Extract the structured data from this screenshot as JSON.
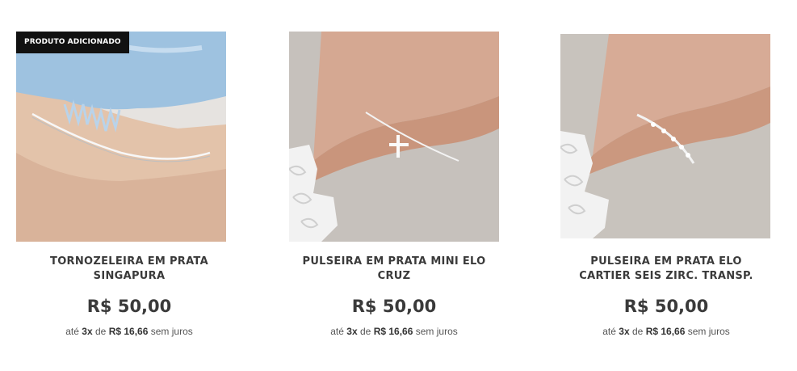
{
  "badge": {
    "label": "PRODUTO ADICIONADO"
  },
  "products": [
    {
      "name_line1": "TORNOZELEIRA EM PRATA",
      "name_line2": "SINGAPURA",
      "price": "R$ 50,00",
      "installments": {
        "prefix": "até",
        "count": "3x",
        "mid": "de",
        "value": "R$ 16,66",
        "suffix": "sem juros"
      },
      "image_icon": "anklet-photo"
    },
    {
      "name_line1": "PULSEIRA EM PRATA MINI ELO",
      "name_line2": "CRUZ",
      "price": "R$ 50,00",
      "installments": {
        "prefix": "até",
        "count": "3x",
        "mid": "de",
        "value": "R$ 16,66",
        "suffix": "sem juros"
      },
      "image_icon": "cross-bracelet-photo"
    },
    {
      "name_line1": "PULSEIRA EM PRATA ELO",
      "name_line2": "CARTIER SEIS ZIRC. TRANSP.",
      "price": "R$ 50,00",
      "installments": {
        "prefix": "até",
        "count": "3x",
        "mid": "de",
        "value": "R$ 16,66",
        "suffix": "sem juros"
      },
      "image_icon": "zirconia-bracelet-photo"
    }
  ]
}
